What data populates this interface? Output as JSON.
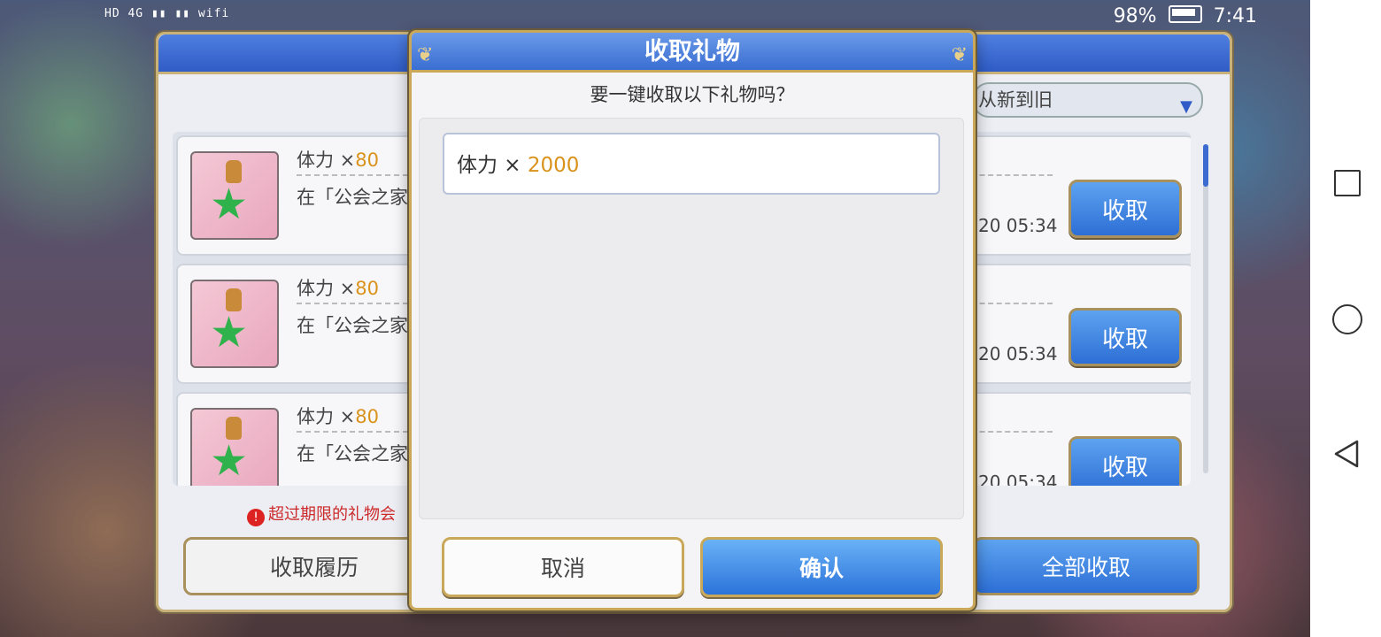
{
  "status_bar": {
    "left_indicators": "HD 4G ▮▮ ▮▮ wifi",
    "battery_percent": "98%",
    "time": "7:41"
  },
  "background_panel": {
    "sort_label": "从新到旧",
    "gift_items": [
      {
        "name": "体力 ×",
        "amount": "80",
        "desc": "在「公会之家",
        "time": "20 05:34",
        "button": "收取"
      },
      {
        "name": "体力 ×",
        "amount": "80",
        "desc": "在「公会之家",
        "time": "20 05:34",
        "button": "收取"
      },
      {
        "name": "体力 ×",
        "amount": "80",
        "desc": "在「公会之家",
        "time": "20 05:34",
        "button": "收取"
      }
    ],
    "warning": "超过期限的礼物会",
    "history_button": "收取履历",
    "collect_all_button": "全部收取"
  },
  "dialog": {
    "title": "收取礼物",
    "question": "要一键收取以下礼物吗？",
    "item_name": "体力 ×",
    "item_amount": "2000",
    "cancel_button": "取消",
    "confirm_button": "确认"
  },
  "colors": {
    "accent_blue": "#2f5cc6",
    "gold_border": "#c9a85a",
    "amount_orange": "#d9931c"
  }
}
